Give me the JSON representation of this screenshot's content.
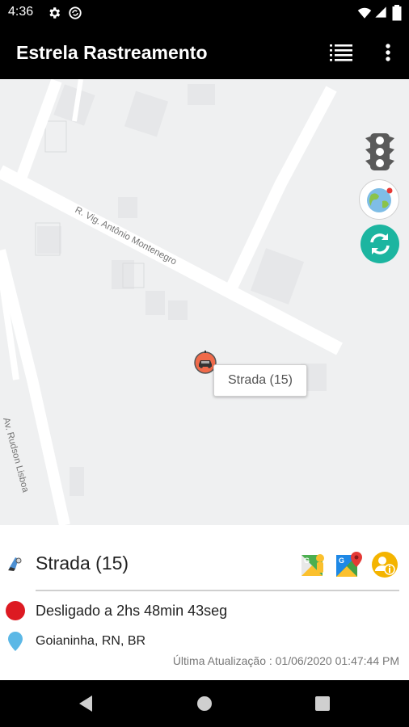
{
  "status_bar": {
    "time": "4:36",
    "icons": [
      "settings-icon",
      "sync-icon",
      "wifi-icon",
      "cellular-icon",
      "battery-icon"
    ]
  },
  "app_bar": {
    "title": "Estrela Rastreamento",
    "actions": [
      "list-icon",
      "more-vert-icon"
    ]
  },
  "map": {
    "street_labels": [
      "R. Vig. Antônio Montenegro",
      "Av. Rudson Lisboa"
    ],
    "marker_label": "Strada (15)",
    "controls": [
      "traffic-light-icon",
      "globe-icon",
      "refresh-icon"
    ]
  },
  "vehicle": {
    "name": "Strada (15)",
    "status_text": "Desligado a 2hs 48min 43seg",
    "status_color": "#dd1a22",
    "location": "Goianinha, RN, BR",
    "last_update": "Última Atualização : 01/06/2020 01:47:44 PM",
    "actions": [
      "street-view-icon",
      "google-maps-icon",
      "vehicle-info-icon"
    ]
  },
  "colors": {
    "app_bar": "#000000",
    "refresh_button": "#1cb5a0",
    "marker": "#f06a4a",
    "info_button": "#f4b400"
  },
  "nav_bar": [
    "back-icon",
    "home-icon",
    "recents-icon"
  ]
}
